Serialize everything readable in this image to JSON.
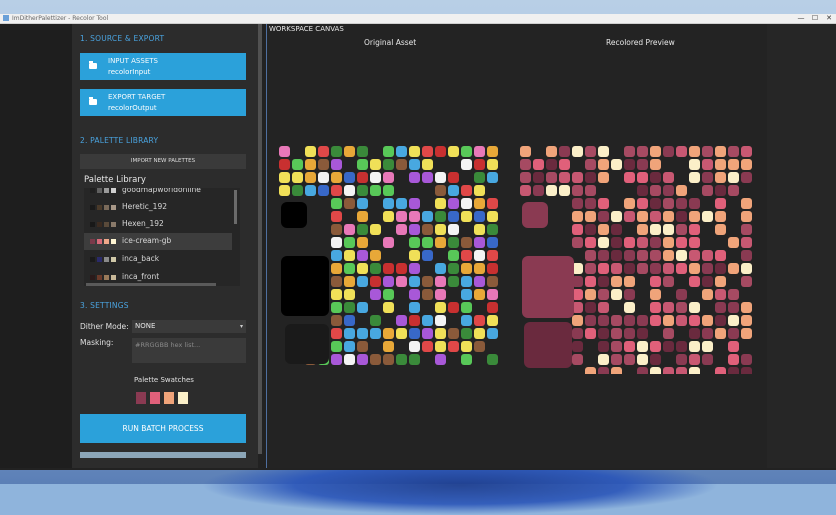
{
  "window": {
    "title": "ImDitherPalettizer - Recolor Tool"
  },
  "titlebar_controls": {
    "minimize": "—",
    "maximize": "☐",
    "close": "✕"
  },
  "sidebar": {
    "section1": "1. SOURCE & EXPORT",
    "input_assets": {
      "label": "INPUT ASSETS",
      "value": "recolorInput",
      "icon": "folder-icon"
    },
    "export_target": {
      "label": "EXPORT TARGET",
      "value": "recolorOutput",
      "icon": "folder-icon"
    },
    "section2": "2. PALETTE LIBRARY",
    "import_button": "IMPORT NEW PALETTES",
    "library_title": "Palette Library",
    "palettes": [
      {
        "name": "goodmapworldonline",
        "colors": [
          "#202020",
          "#606060",
          "#9a9a9a",
          "#d0d0d0"
        ]
      },
      {
        "name": "Heretic_192",
        "colors": [
          "#1a1a1a",
          "#4a3a2a",
          "#7a6a5a",
          "#a89888"
        ]
      },
      {
        "name": "Hexen_192",
        "colors": [
          "#181818",
          "#3a2a20",
          "#5a4a3a",
          "#8a7a6a"
        ]
      },
      {
        "name": "ice-cream-gb",
        "colors": [
          "#7a3a4a",
          "#d86a7a",
          "#f0a88a",
          "#fff6d3"
        ]
      },
      {
        "name": "inca_back",
        "colors": [
          "#1a1a1a",
          "#2a2a6a",
          "#8a8a8a",
          "#d0c8a8"
        ]
      },
      {
        "name": "inca_front",
        "colors": [
          "#2a1a1a",
          "#6a3a2a",
          "#9a7a5a",
          "#c8b898"
        ]
      }
    ],
    "section3": "3. SETTINGS",
    "dither_label": "Dither Mode:",
    "dither_value": "NONE",
    "masking_label": "Masking:",
    "masking_placeholder": "#RRGGBB hex list...",
    "swatches_label": "Palette Swatches",
    "swatches": [
      "#8a3a52",
      "#e0607a",
      "#f0a47a",
      "#fbefc8"
    ],
    "run_button": "RUN BATCH PROCESS"
  },
  "canvas": {
    "title": "WORKSPACE CANVAS",
    "original_caption": "Original Asset",
    "preview_caption": "Recolored Preview"
  }
}
